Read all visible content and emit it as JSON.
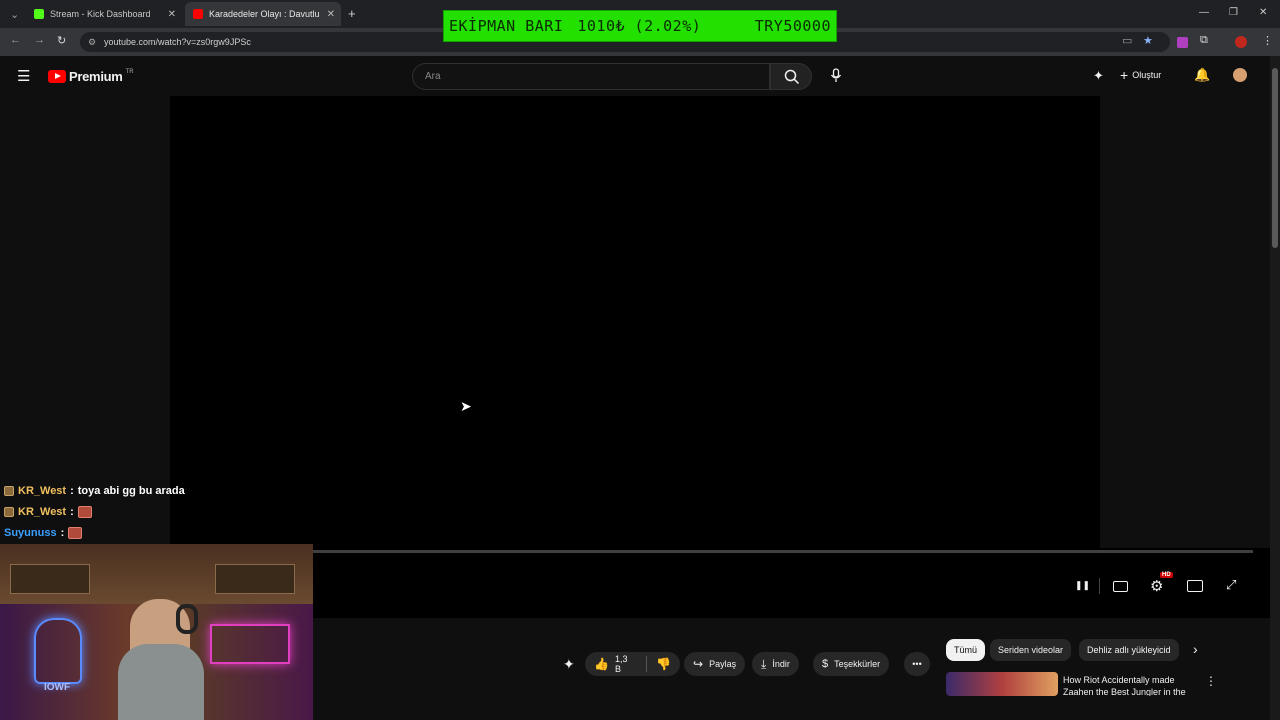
{
  "browser": {
    "tabs": [
      {
        "title": "Stream - Kick Dashboard",
        "active": false,
        "icon": "kick-icon"
      },
      {
        "title": "Karadedeler Olayı : Davutlu Köy",
        "active": true,
        "icon": "youtube-icon"
      }
    ],
    "url": "youtube.com/watch?v=zs0rgw9JPSc"
  },
  "overlay": {
    "label": "EKİPMAN BARI",
    "amount": "1010₺ (2.02%)",
    "goal": "TRY50000",
    "color": "#22e000"
  },
  "youtube": {
    "logo_text": "Premium",
    "region": "TR",
    "search_placeholder": "Ara",
    "create_label": "Oluştur",
    "accent": "#ff0000"
  },
  "player": {
    "quality_badge": "HD",
    "progress": 0.0
  },
  "actions": {
    "likes": "1,3 B",
    "share": "Paylaş",
    "download": "İndir",
    "thanks": "Teşekkürler"
  },
  "chips": [
    "Tümü",
    "Seriden videolar",
    "Dehliz adlı yükleyicid"
  ],
  "recommended": {
    "title": "How Riot Accidentally made Zaahen the Best Jungler in the"
  },
  "chat": [
    {
      "user": "KR_West",
      "message": "toya abi gg bu arada",
      "color": "#f0c060",
      "badge": true,
      "emote": false
    },
    {
      "user": "KR_West",
      "message": "",
      "color": "#f0c060",
      "badge": true,
      "emote": true
    },
    {
      "user": "Suyunuss",
      "message": "",
      "color": "#3aa0ff",
      "badge": false,
      "emote": true
    }
  ],
  "webcam": {
    "neon_sign": "IOWF"
  }
}
